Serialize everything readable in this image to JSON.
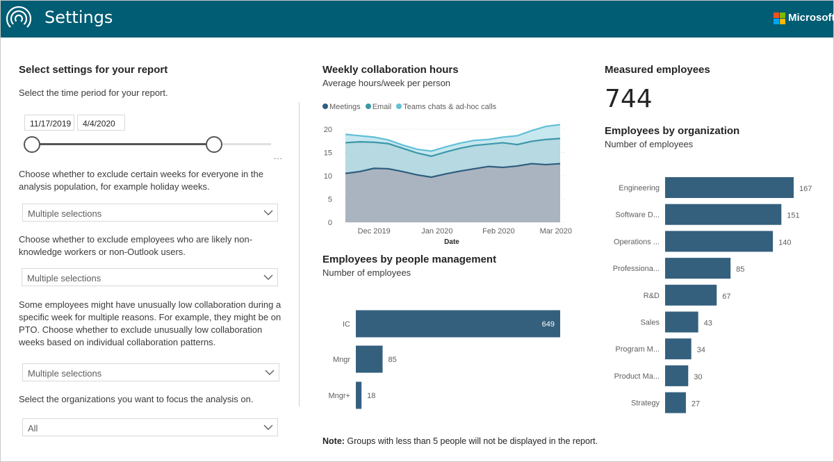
{
  "app": {
    "title": "Settings",
    "brand": "Microsoft",
    "header_color": "#005d73"
  },
  "settings": {
    "heading": "Select settings for your report",
    "time_period_prompt": "Select the time period for your report.",
    "start_date": "11/17/2019",
    "end_date": "4/4/2020",
    "slider_more": "...",
    "exclude_weeks_prompt": "Choose whether to exclude certain weeks for everyone in the analysis population, for example holiday weeks.",
    "exclude_weeks_value": "Multiple selections",
    "exclude_employees_prompt": "Choose whether to exclude employees who are likely non-knowledge workers or non-Outlook users.",
    "exclude_employees_value": "Multiple selections",
    "low_collab_prompt": "Some employees might have unusually low collaboration during a specific week for multiple reasons. For example, they might be on PTO. Choose whether to exclude unusually low collaboration weeks based on individual collaboration patterns.",
    "low_collab_value": "Multiple selections",
    "organizations_prompt": "Select the organizations you want to focus the analysis on.",
    "organizations_value": "All"
  },
  "weekly_chart": {
    "title": "Weekly collaboration hours",
    "subtitle": "Average hours/week per person",
    "legend": [
      {
        "name": "Meetings",
        "color": "#2e5d7e"
      },
      {
        "name": "Email",
        "color": "#3c97a8"
      },
      {
        "name": "Teams chats & ad-hoc calls",
        "color": "#5fc0d6"
      }
    ]
  },
  "people_mgmt": {
    "title": "Employees by people management",
    "subtitle": "Number of employees"
  },
  "measured": {
    "title": "Measured employees",
    "value": "744"
  },
  "org_chart": {
    "title": "Employees by organization",
    "subtitle": "Number of employees"
  },
  "note": {
    "label": "Note:",
    "text": " Groups with less than 5 people will not be displayed in the report."
  },
  "chart_data": [
    {
      "type": "area",
      "title": "Weekly collaboration hours",
      "subtitle": "Average hours/week per person",
      "xlabel": "Date",
      "ylabel": "",
      "ylim": [
        0,
        20
      ],
      "yticks": [
        0,
        5,
        10,
        15,
        20
      ],
      "xtick_labels": [
        "Dec 2019",
        "Jan 2020",
        "Feb 2020",
        "Mar 2020"
      ],
      "xtick_weeks": [
        2,
        6.4,
        10.7,
        14.7
      ],
      "stacked_cumulative": true,
      "series": [
        {
          "name": "Meetings",
          "color": "#2e5d7e",
          "values": [
            10.5,
            10.9,
            11.6,
            11.5,
            10.9,
            10.2,
            9.7,
            10.4,
            11.0,
            11.5,
            12.0,
            11.8,
            12.1,
            12.6,
            12.4,
            12.6
          ]
        },
        {
          "name": "Email",
          "color": "#3c97a8",
          "values": [
            17.1,
            17.3,
            17.2,
            16.9,
            15.9,
            14.9,
            14.2,
            15.1,
            15.9,
            16.5,
            16.8,
            17.1,
            16.7,
            17.4,
            17.8,
            18.0
          ]
        },
        {
          "name": "Teams chats & ad-hoc calls",
          "color": "#5fc0d6",
          "values": [
            18.9,
            18.6,
            18.3,
            17.7,
            16.6,
            15.7,
            15.3,
            16.2,
            17.0,
            17.6,
            17.8,
            18.3,
            18.6,
            19.7,
            20.6,
            21.0
          ]
        }
      ]
    },
    {
      "type": "bar",
      "orientation": "horizontal",
      "title": "Employees by people management",
      "subtitle": "Number of employees",
      "categories": [
        "IC",
        "Mngr",
        "Mngr+"
      ],
      "values": [
        649,
        85,
        18
      ],
      "color": "#34607e"
    },
    {
      "type": "bar",
      "orientation": "horizontal",
      "title": "Employees by organization",
      "subtitle": "Number of employees",
      "categories": [
        "Engineering",
        "Software D...",
        "Operations ...",
        "Professiona...",
        "R&D",
        "Sales",
        "Program M...",
        "Product Ma...",
        "Strategy"
      ],
      "values": [
        167,
        151,
        140,
        85,
        67,
        43,
        34,
        30,
        27
      ],
      "color": "#34607e"
    }
  ]
}
